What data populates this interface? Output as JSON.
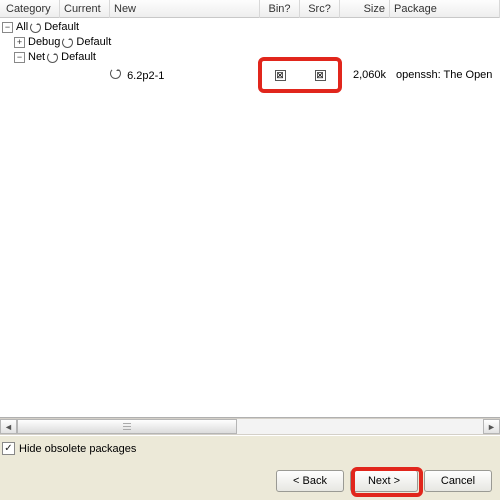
{
  "columns": {
    "category": "Category",
    "current": "Current",
    "new": "New",
    "bin": "Bin?",
    "src": "Src?",
    "size": "Size",
    "package": "Package"
  },
  "tree": {
    "root": {
      "name": "All",
      "state": "Default",
      "expander": "−"
    },
    "debug": {
      "name": "Debug",
      "state": "Default",
      "expander": "+"
    },
    "net": {
      "name": "Net",
      "state": "Default",
      "expander": "−"
    }
  },
  "pkg": {
    "new_version": "6.2p2-1",
    "bin_checked": "⊠",
    "src_checked": "⊠",
    "size": "2,060k",
    "desc": "openssh: The Open"
  },
  "hide_obsolete": {
    "label": "Hide obsolete packages",
    "checked_glyph": "✓"
  },
  "buttons": {
    "back": "< Back",
    "next": "Next >",
    "cancel": "Cancel"
  },
  "scroll": {
    "left_glyph": "◄",
    "right_glyph": "►"
  }
}
